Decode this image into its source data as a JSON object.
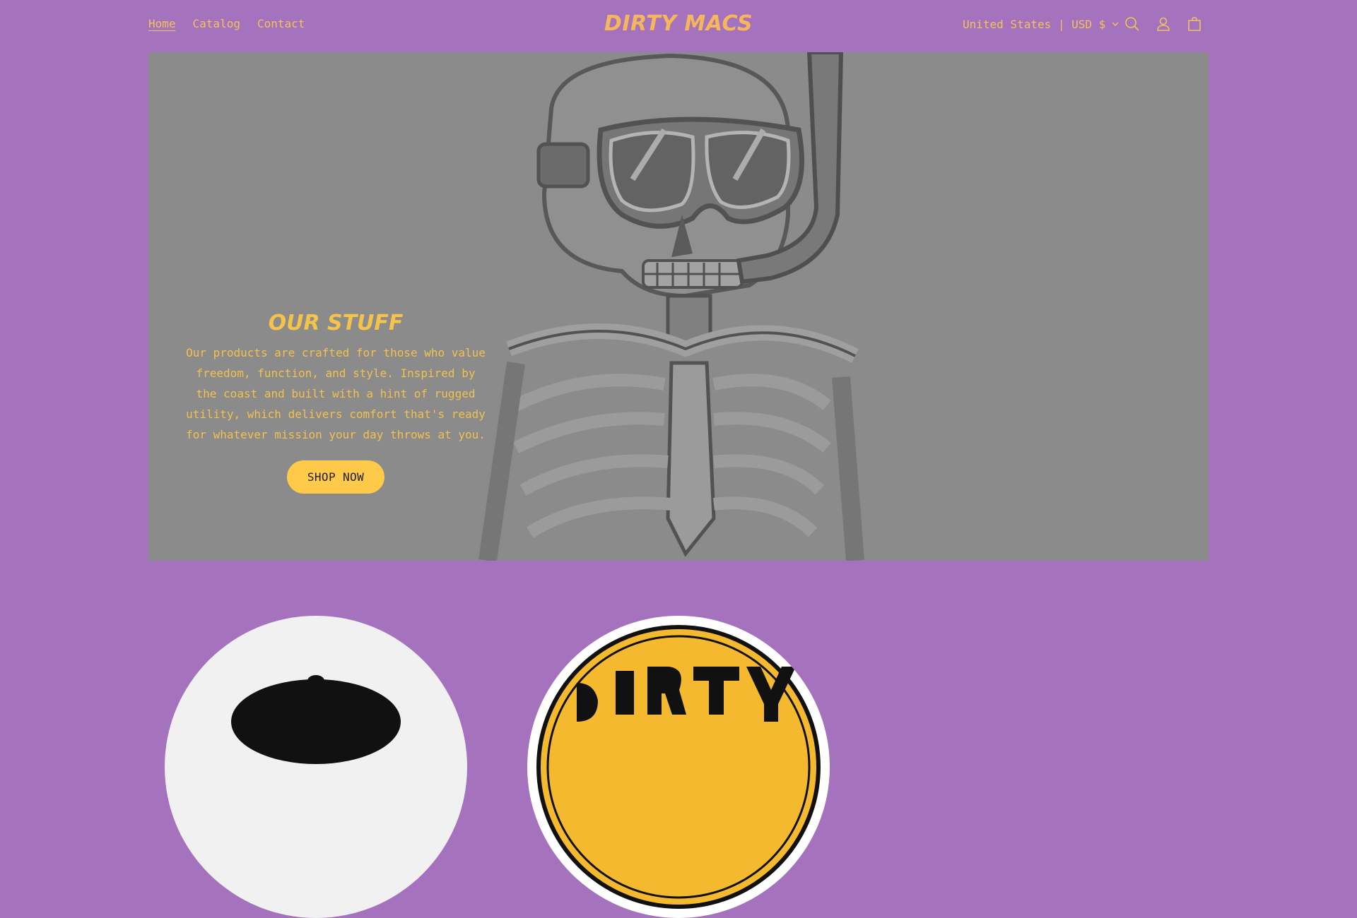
{
  "header": {
    "nav": [
      {
        "label": "Home"
      },
      {
        "label": "Catalog"
      },
      {
        "label": "Contact"
      }
    ],
    "logo": "DIRTY MACS",
    "locale": "United States | USD $"
  },
  "hero": {
    "title": "OUR STUFF",
    "description": "Our products are crafted for those who value freedom, function, and style. Inspired by the coast and built with a hint of rugged utility, which delivers comfort that's ready for whatever mission your day throws at you.",
    "button_label": "SHOP NOW"
  },
  "collections": [
    {
      "name": "cap-collection"
    },
    {
      "name": "sticker-collection"
    }
  ],
  "colors": {
    "background": "#a572bd",
    "accent": "#f6c34a",
    "button": "#ffc94a",
    "hero_overlay": "#8b8b8b"
  },
  "icons": [
    "search-icon",
    "account-icon",
    "cart-icon",
    "chevron-down-icon"
  ]
}
